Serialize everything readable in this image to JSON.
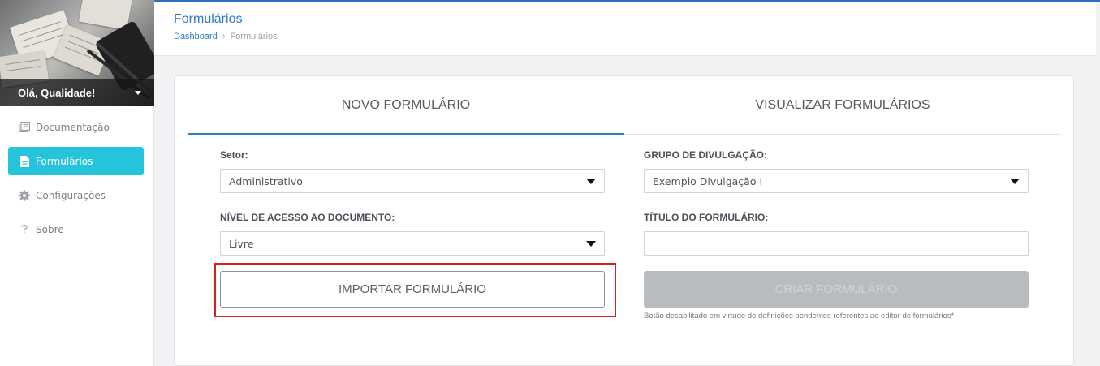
{
  "sidebar": {
    "user_greeting": "Olá, Qualidade!",
    "items": [
      {
        "label": "Documentação",
        "icon": "book-icon",
        "active": false
      },
      {
        "label": "Formulários",
        "icon": "file-icon",
        "active": true
      },
      {
        "label": "Configurações",
        "icon": "gear-icon",
        "active": false
      },
      {
        "label": "Sobre",
        "icon": "question-icon",
        "active": false
      }
    ]
  },
  "header": {
    "title": "Formulários",
    "breadcrumb": [
      "Dashboard",
      "Formulários"
    ]
  },
  "tabs": [
    {
      "label": "NOVO FORMULÁRIO",
      "active": true
    },
    {
      "label": "VISUALIZAR FORMULÁRIOS",
      "active": false
    }
  ],
  "form": {
    "setor_label": "Setor:",
    "setor_value": "Administrativo",
    "nivel_label": "NÍVEL DE ACESSO AO DOCUMENTO:",
    "nivel_value": "Livre",
    "grupo_label": "GRUPO DE DIVULGAÇÃO:",
    "grupo_value": "Exemplo Divulgação I",
    "titulo_label": "TÍTULO DO FORMULÁRIO:",
    "titulo_value": "",
    "import_button": "IMPORTAR FORMULÁRIO",
    "create_button": "CRIAR FORMULÁRIO",
    "create_disabled_hint": "Botão desabilitado em virtude de definições pendentes referentes ao editor de formulários*"
  },
  "colors": {
    "accent": "#2f7bc6",
    "active_nav": "#26c4dc",
    "highlight": "#d71f23",
    "disabled_button": "#b8bcc1"
  }
}
